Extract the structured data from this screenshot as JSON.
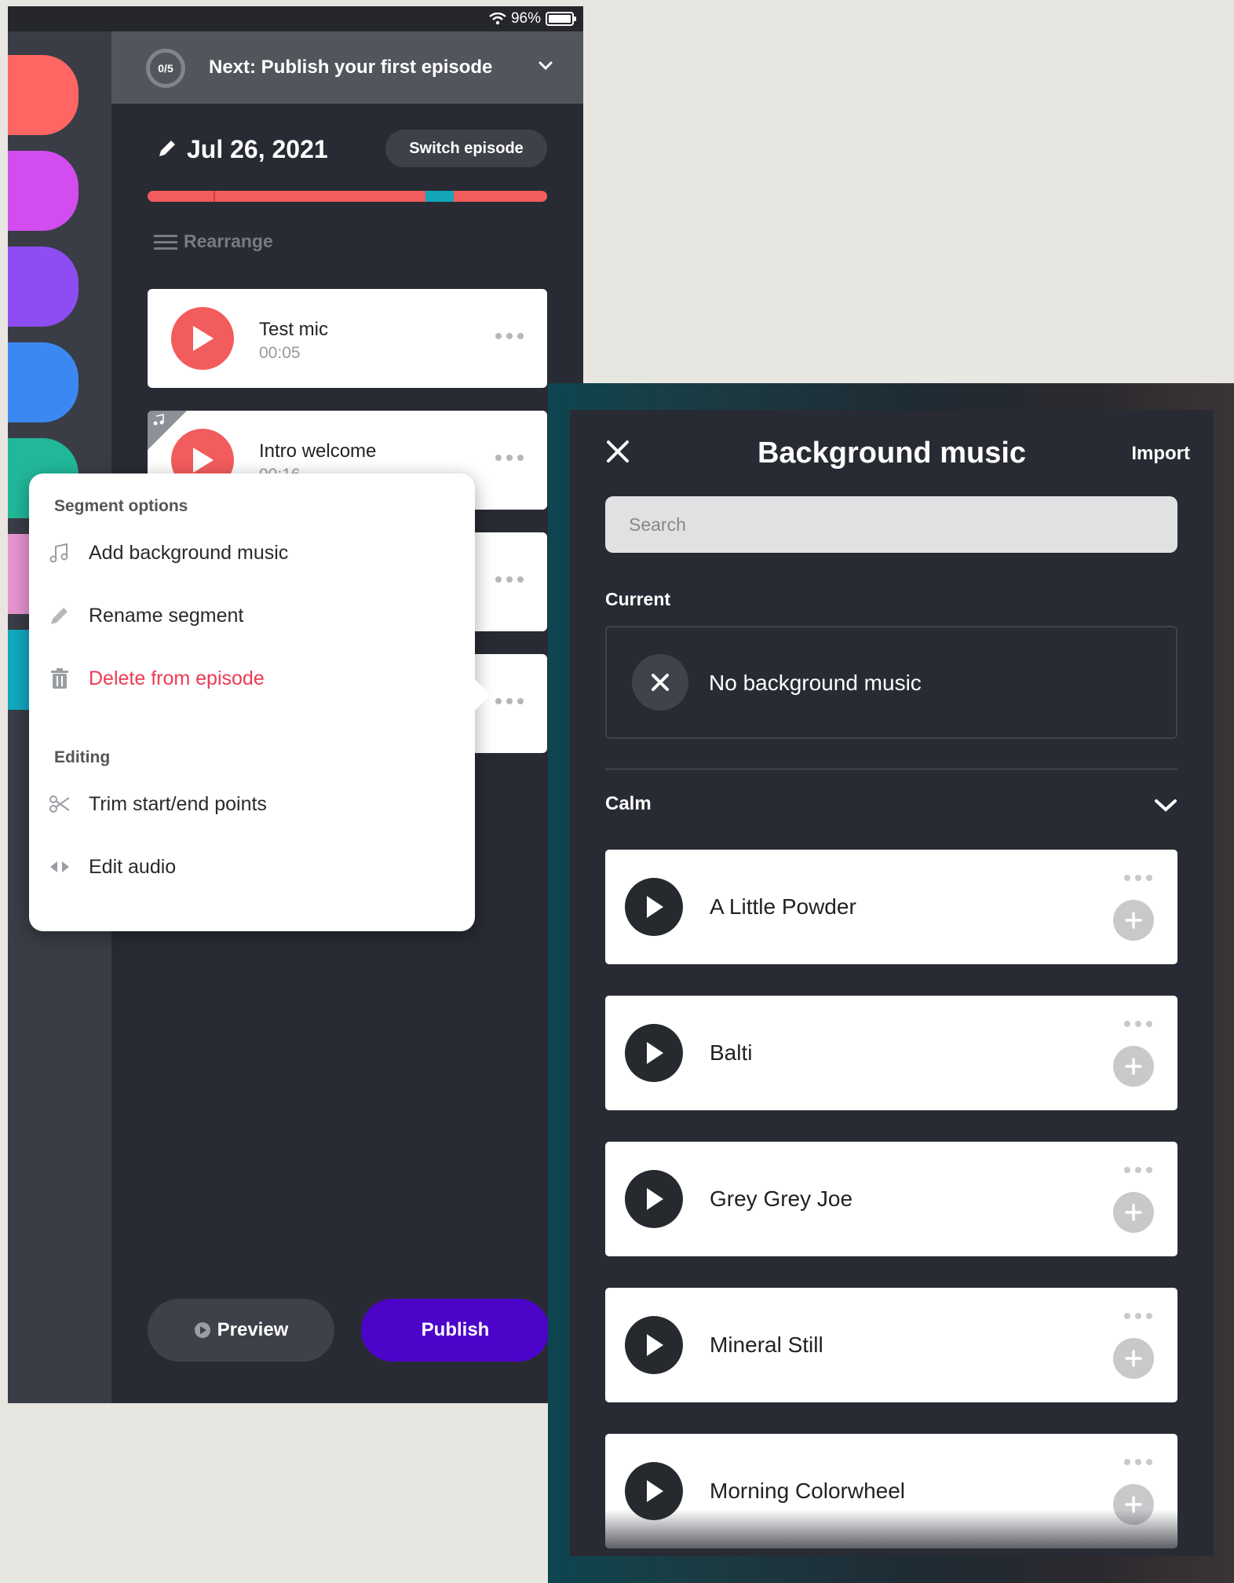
{
  "status_bar": {
    "battery": "96%"
  },
  "sidebar": {
    "pill_colors": [
      "#ff6663",
      "#d24cf0",
      "#8e4df2",
      "#3b88f2",
      "#21b89a",
      "#e694d0",
      "#12a9bf"
    ]
  },
  "next_banner": {
    "progress": "0/5",
    "text": "Next: Publish your first episode"
  },
  "episode": {
    "date": "Jul 26, 2021",
    "switch_label": "Switch episode",
    "rearrange_label": "Rearrange",
    "segments": [
      {
        "title": "Test mic",
        "duration": "00:05",
        "has_music": false
      },
      {
        "title": "Intro welcome",
        "duration": "00:16",
        "has_music": true
      }
    ],
    "preview_label": "Preview",
    "publish_label": "Publish"
  },
  "context_menu": {
    "section1": "Segment options",
    "add_music": "Add background music",
    "rename": "Rename segment",
    "delete": "Delete from episode",
    "section2": "Editing",
    "trim": "Trim start/end points",
    "edit_audio": "Edit audio"
  },
  "background_music": {
    "title": "Background music",
    "import_label": "Import",
    "search_placeholder": "Search",
    "current_label": "Current",
    "current_value": "No background music",
    "category": "Calm",
    "tracks": [
      "A Little Powder",
      "Balti",
      "Grey Grey Joe",
      "Mineral Still",
      "Morning Colorwheel"
    ]
  },
  "colors": {
    "accent_red": "#f25c5c",
    "publish_purple": "#4d04c9",
    "danger": "#ea3b55",
    "timeline_teal": "#13a5b8"
  }
}
